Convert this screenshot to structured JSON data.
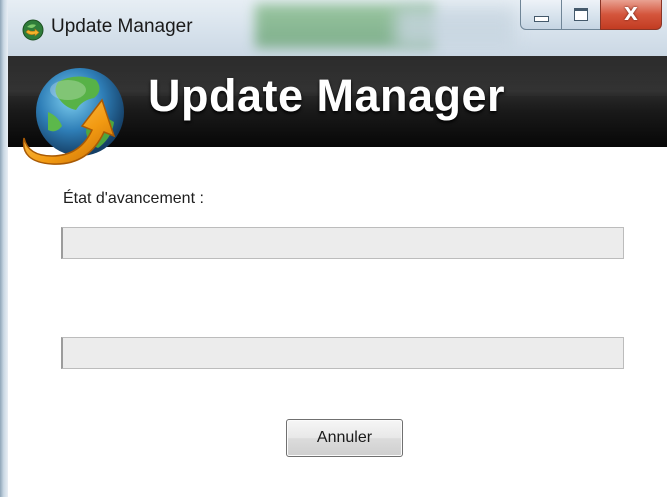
{
  "window": {
    "title": "Update Manager",
    "app_icon": "update-globe-icon",
    "controls": {
      "minimize": "minimize-icon",
      "maximize": "maximize-icon",
      "close": "close-icon",
      "close_glyph": "X"
    }
  },
  "banner": {
    "title": "Update Manager",
    "logo_icon": "globe-arrow-icon"
  },
  "main": {
    "status_label": "État d'avancement :",
    "progress_bars": [
      {
        "value": 0
      },
      {
        "value": 0
      }
    ],
    "cancel_label": "Annuler"
  },
  "colors": {
    "banner_background": "#1a1a1a",
    "banner_text": "#ffffff",
    "close_button": "#c94a32",
    "progress_track": "#ececec"
  }
}
